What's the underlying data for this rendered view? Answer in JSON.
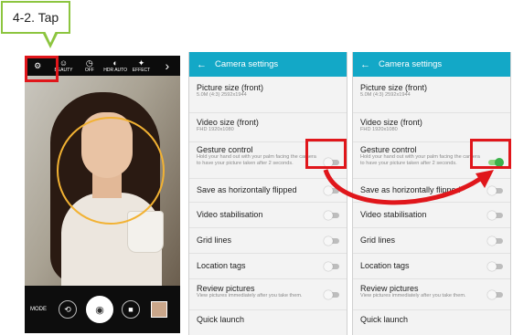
{
  "callout": {
    "text": "4-2. Tap"
  },
  "camera": {
    "top_bar": [
      {
        "icon": "gear-icon",
        "label": ""
      },
      {
        "icon": "beauty-face-icon",
        "label": "BEAUTY"
      },
      {
        "icon": "timer-icon",
        "label": "OFF"
      },
      {
        "icon": "hdr-icon",
        "label": "HDR AUTO"
      },
      {
        "icon": "effect-icon",
        "label": "EFFECT"
      },
      {
        "icon": "chevron-right-icon",
        "label": ""
      }
    ],
    "mode_label": "MODE",
    "icons": {
      "gear": "⚙",
      "beauty": "☺",
      "timer": "◷",
      "hdr": "◐",
      "effect": "✦",
      "more": "›",
      "switch_camera": "⟲",
      "shutter": "◉",
      "video": "■"
    }
  },
  "settings_before": {
    "header": {
      "back": "←",
      "title": "Camera settings"
    },
    "picture_size": {
      "title": "Picture size (front)",
      "value": "5.0M (4:3) 2592x1944"
    },
    "video_size": {
      "title": "Video size (front)",
      "value": "FHD 1920x1080"
    },
    "gesture": {
      "title": "Gesture control",
      "desc": "Hold your hand out with your palm facing the camera to have your picture taken after 2 seconds.",
      "on": false
    },
    "flip": {
      "title": "Save as horizontally flipped",
      "on": false
    },
    "stabilisation": {
      "title": "Video stabilisation",
      "on": false
    },
    "grid": {
      "title": "Grid lines",
      "on": false
    },
    "location": {
      "title": "Location tags",
      "on": false
    },
    "review": {
      "title": "Review pictures",
      "desc": "View pictures immediately after you take them.",
      "on": false
    },
    "quick_launch": {
      "title": "Quick launch"
    }
  },
  "settings_after": {
    "header": {
      "back": "←",
      "title": "Camera settings"
    },
    "picture_size": {
      "title": "Picture size (front)",
      "value": "5.0M (4:3) 2592x1944"
    },
    "video_size": {
      "title": "Video size (front)",
      "value": "FHD 1920x1080"
    },
    "gesture": {
      "title": "Gesture control",
      "desc": "Hold your hand out with your palm facing the camera to have your picture taken after 2 seconds.",
      "on": true
    },
    "flip": {
      "title": "Save as horizontally flipped",
      "on": false
    },
    "stabilisation": {
      "title": "Video stabilisation",
      "on": false
    },
    "grid": {
      "title": "Grid lines",
      "on": false
    },
    "location": {
      "title": "Location tags",
      "on": false
    },
    "review": {
      "title": "Review pictures",
      "desc": "View pictures immediately after you take them.",
      "on": false
    },
    "quick_launch": {
      "title": "Quick launch"
    }
  },
  "colors": {
    "header": "#13a8c7",
    "highlight": "#e0161b",
    "callout_border": "#8cc53f",
    "face_ring": "#f2b233",
    "toggle_on": "#3bb14a"
  }
}
